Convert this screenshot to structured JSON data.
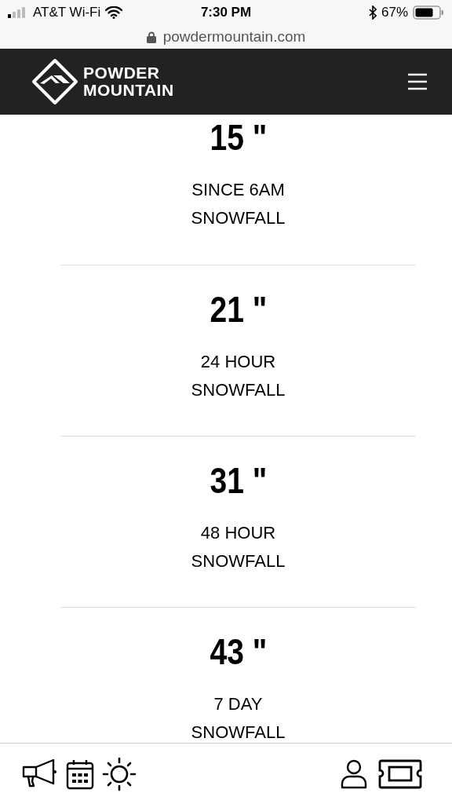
{
  "status_bar": {
    "carrier": "AT&T Wi-Fi",
    "time": "7:30 PM",
    "battery": "67%"
  },
  "address_bar": {
    "url": "powdermountain.com"
  },
  "header": {
    "logo_line_1": "POWDER",
    "logo_line_2": "MOUNTAIN"
  },
  "stats": [
    {
      "value": "15 \"",
      "label_line_1": "SINCE 6AM",
      "label_line_2": "SNOWFALL"
    },
    {
      "value": "21 \"",
      "label_line_1": "24 HOUR",
      "label_line_2": "SNOWFALL"
    },
    {
      "value": "31 \"",
      "label_line_1": "48 HOUR",
      "label_line_2": "SNOWFALL"
    },
    {
      "value": "43 \"",
      "label_line_1": "7 DAY",
      "label_line_2": "SNOWFALL"
    }
  ]
}
